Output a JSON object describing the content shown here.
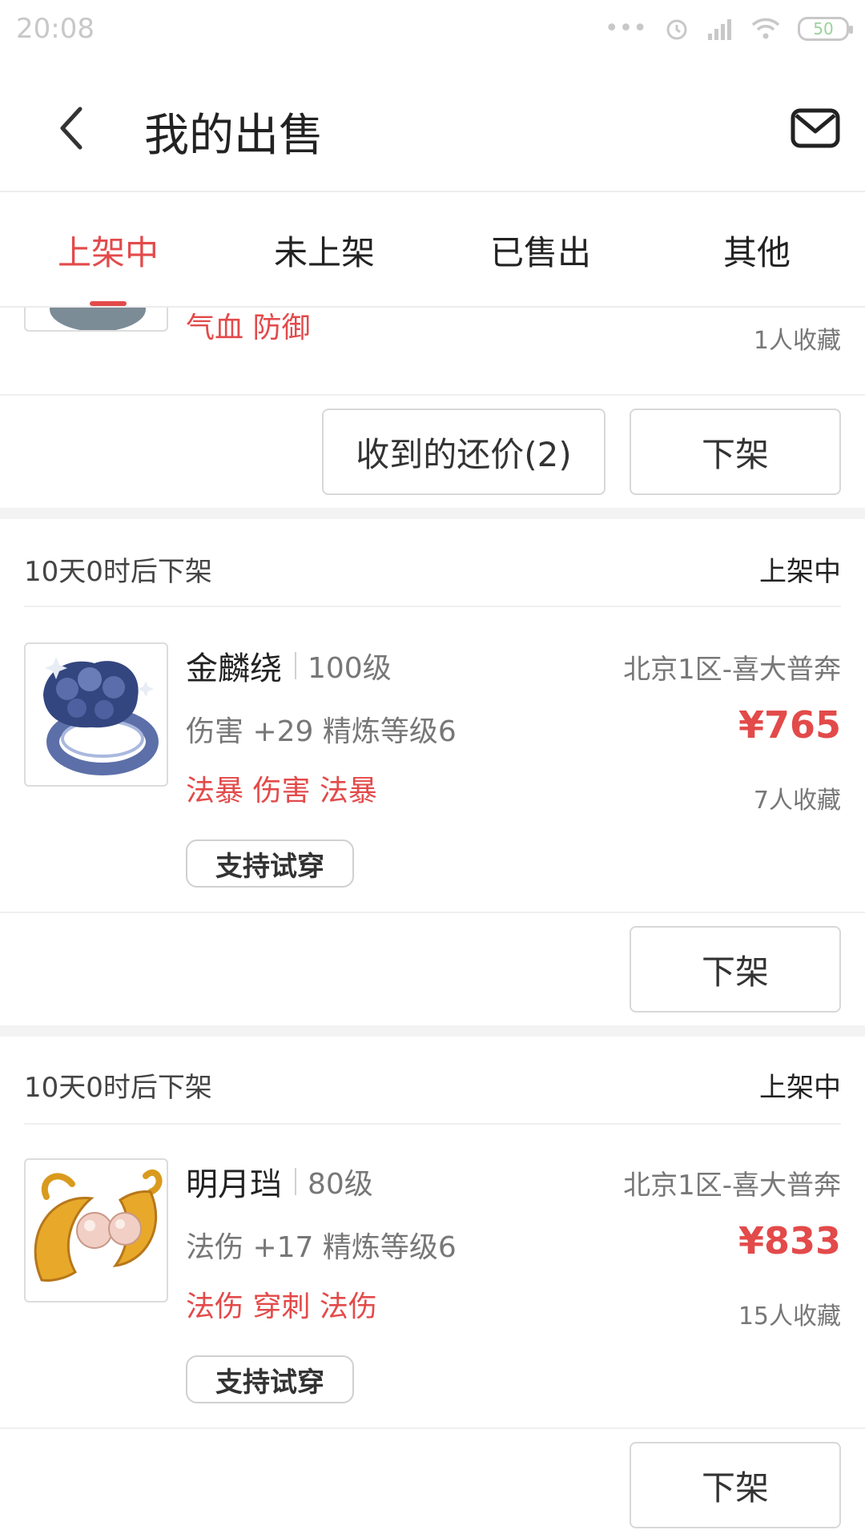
{
  "status_bar": {
    "time": "20:08",
    "battery": "50"
  },
  "header": {
    "title": "我的出售"
  },
  "tabs": [
    {
      "label": "上架中",
      "active": true
    },
    {
      "label": "未上架",
      "active": false
    },
    {
      "label": "已售出",
      "active": false
    },
    {
      "label": "其他",
      "active": false
    }
  ],
  "partial_listing": {
    "tags": "气血 防御",
    "favorites": "1人收藏",
    "offers_button": "收到的还价(2)",
    "delist_button": "下架"
  },
  "listings": [
    {
      "timer": "10天0时后下架",
      "state": "上架中",
      "name": "金麟绕",
      "level": "100级",
      "server": "北京1区-喜大普奔",
      "attrs": "伤害 +29 精炼等级6",
      "price": "¥765",
      "tags": "法暴 伤害 法暴",
      "favorites": "7人收藏",
      "tryon": "支持试穿",
      "delist_button": "下架"
    },
    {
      "timer": "10天0时后下架",
      "state": "上架中",
      "name": "明月珰",
      "level": "80级",
      "server": "北京1区-喜大普奔",
      "attrs": "法伤 +17 精炼等级6",
      "price": "¥833",
      "tags": "法伤 穿刺 法伤",
      "favorites": "15人收藏",
      "tryon": "支持试穿",
      "delist_button": "下架"
    }
  ],
  "colors": {
    "accent": "#e34a4a",
    "muted": "#777777"
  }
}
